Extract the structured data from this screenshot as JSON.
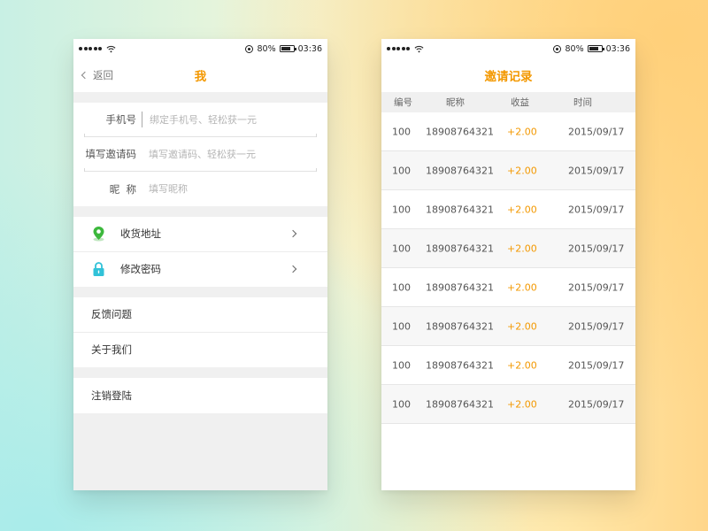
{
  "status_bar": {
    "battery_percent": "80%",
    "time": "03:36",
    "battery_level": 0.8
  },
  "profile_screen": {
    "back_label": "返回",
    "title": "我",
    "form": {
      "phone_label": "手机号",
      "phone_placeholder": "绑定手机号、轻松获一元",
      "invite_label": "填写邀请码",
      "invite_placeholder": "填写邀请码、轻松获一元",
      "nickname_label": "昵  称",
      "nickname_placeholder": "填写昵称"
    },
    "menu_primary": [
      {
        "label": "收货地址",
        "icon": "location-pin-icon",
        "color": "#3cb83c"
      },
      {
        "label": "修改密码",
        "icon": "lock-icon",
        "color": "#31c2d8"
      }
    ],
    "menu_secondary": [
      {
        "label": "反馈问题"
      },
      {
        "label": "关于我们"
      }
    ],
    "menu_logout": {
      "label": "注销登陆"
    }
  },
  "invite_screen": {
    "title": "邀请记录",
    "columns": [
      "编号",
      "昵称",
      "收益",
      "时间"
    ],
    "rows": [
      {
        "id": "100",
        "nickname": "18908764321",
        "earning": "+2.00",
        "time": "2015/09/17"
      },
      {
        "id": "100",
        "nickname": "18908764321",
        "earning": "+2.00",
        "time": "2015/09/17"
      },
      {
        "id": "100",
        "nickname": "18908764321",
        "earning": "+2.00",
        "time": "2015/09/17"
      },
      {
        "id": "100",
        "nickname": "18908764321",
        "earning": "+2.00",
        "time": "2015/09/17"
      },
      {
        "id": "100",
        "nickname": "18908764321",
        "earning": "+2.00",
        "time": "2015/09/17"
      },
      {
        "id": "100",
        "nickname": "18908764321",
        "earning": "+2.00",
        "time": "2015/09/17"
      },
      {
        "id": "100",
        "nickname": "18908764321",
        "earning": "+2.00",
        "time": "2015/09/17"
      },
      {
        "id": "100",
        "nickname": "18908764321",
        "earning": "+2.00",
        "time": "2015/09/17"
      }
    ]
  },
  "colors": {
    "accent": "#f39800",
    "page_gray": "#f0f0f0"
  }
}
